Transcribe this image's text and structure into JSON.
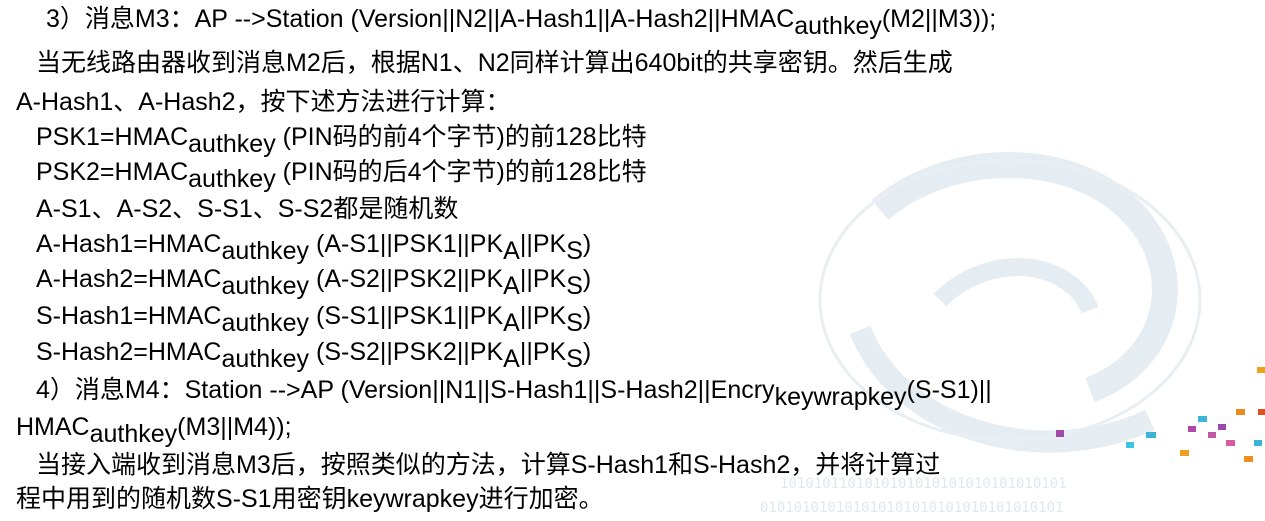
{
  "lines": [
    {
      "parts": [
        {
          "t": "3）消息M3：AP -->Station (Version||N2||A-Hash1||A-Hash2||HMAC"
        },
        {
          "t": "authkey",
          "sub": true
        },
        {
          "t": "(M2||M3));"
        }
      ]
    },
    {
      "parts": [
        {
          "t": "当无线路由器收到消息M2后，根据N1、N2同样计算出640bit的共享密钥。然后生成"
        }
      ]
    },
    {
      "parts": [
        {
          "t": "A-Hash1、A-Hash2，按下述方法进行计算："
        }
      ]
    },
    {
      "parts": [
        {
          "t": "PSK1=HMAC"
        },
        {
          "t": "authkey",
          "sub": true
        },
        {
          "t": " (PIN码的前4个字节)的前128比特"
        }
      ]
    },
    {
      "parts": [
        {
          "t": "PSK2=HMAC"
        },
        {
          "t": "authkey",
          "sub": true
        },
        {
          "t": " (PIN码的后4个字节)的前128比特"
        }
      ]
    },
    {
      "parts": [
        {
          "t": "A-S1、A-S2、S-S1、S-S2都是随机数"
        }
      ]
    },
    {
      "parts": [
        {
          "t": "A-Hash1=HMAC"
        },
        {
          "t": "authkey",
          "sub": true
        },
        {
          "t": " (A-S1||PSK1||PK"
        },
        {
          "t": "A",
          "sub": true
        },
        {
          "t": "||PK"
        },
        {
          "t": "S",
          "sub": true
        },
        {
          "t": ")"
        }
      ]
    },
    {
      "parts": [
        {
          "t": "A-Hash2=HMAC"
        },
        {
          "t": "authkey",
          "sub": true
        },
        {
          "t": " (A-S2||PSK2||PK"
        },
        {
          "t": "A",
          "sub": true
        },
        {
          "t": "||PK"
        },
        {
          "t": "S",
          "sub": true
        },
        {
          "t": ")"
        }
      ]
    },
    {
      "parts": [
        {
          "t": "S-Hash1=HMAC"
        },
        {
          "t": "authkey",
          "sub": true
        },
        {
          "t": " (S-S1||PSK1||PK"
        },
        {
          "t": "A",
          "sub": true
        },
        {
          "t": "||PK"
        },
        {
          "t": "S",
          "sub": true
        },
        {
          "t": ")"
        }
      ]
    },
    {
      "parts": [
        {
          "t": "S-Hash2=HMAC"
        },
        {
          "t": "authkey",
          "sub": true
        },
        {
          "t": " (S-S2||PSK2||PK"
        },
        {
          "t": "A",
          "sub": true
        },
        {
          "t": "||PK"
        },
        {
          "t": "S",
          "sub": true
        },
        {
          "t": ")"
        }
      ]
    },
    {
      "parts": [
        {
          "t": "4）消息M4：Station -->AP (Version||N1||S-Hash1||S-Hash2||Encry"
        },
        {
          "t": "keywrapkey",
          "sub": true
        },
        {
          "t": "(S-S1)||"
        }
      ]
    },
    {
      "parts": [
        {
          "t": "HMAC"
        },
        {
          "t": "authkey",
          "sub": true
        },
        {
          "t": "(M3||M4));"
        }
      ]
    },
    {
      "parts": [
        {
          "t": "当接入端收到消息M3后，按照类似的方法，计算S-Hash1和S-Hash2，并将计算过"
        }
      ]
    },
    {
      "parts": [
        {
          "t": "程中用到的随机数S-S1用密钥keywrapkey进行加密。"
        }
      ]
    }
  ]
}
